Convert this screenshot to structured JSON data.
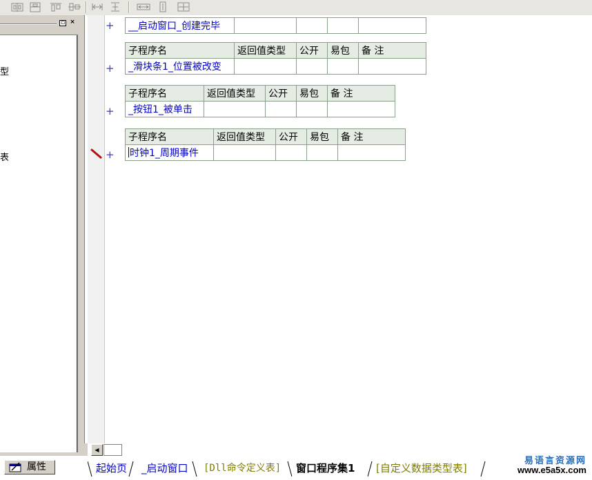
{
  "toolbar": {
    "buttons": [
      "align-left-icon",
      "align-center-icon",
      "align-top-icon",
      "align-middle-icon",
      "space-horizontal-icon",
      "space-vertical-icon",
      "same-width-icon",
      "same-height-icon",
      "same-size-icon"
    ]
  },
  "left_panel": {
    "fragment_1": "型",
    "fragment_2": "表"
  },
  "editor": {
    "first_row": {
      "name": "__启动窗口_创建完毕"
    },
    "headers": {
      "name": "子程序名",
      "return_type": "返回值类型",
      "public": "公开",
      "easy_pkg": "易包",
      "note": "备 注"
    },
    "subs": [
      {
        "name": "_滑块条1_位置被改变"
      },
      {
        "name": "_按钮1_被单击"
      },
      {
        "name": "时钟1_周期事件"
      }
    ],
    "plus_symbol": "+"
  },
  "bottom": {
    "properties_tab": "属性",
    "tabs": [
      {
        "label": "起始页",
        "style": "blue"
      },
      {
        "label": "_启动窗口",
        "style": "blue"
      },
      {
        "label": "[Dll命令定义表]",
        "style": "olive"
      },
      {
        "label": "窗口程序集1",
        "style": "active"
      },
      {
        "label": "[自定义数据类型表]",
        "style": "olive"
      }
    ],
    "watermark_cn": "易语言资源网",
    "watermark_url": "www.e5a5x.com"
  }
}
